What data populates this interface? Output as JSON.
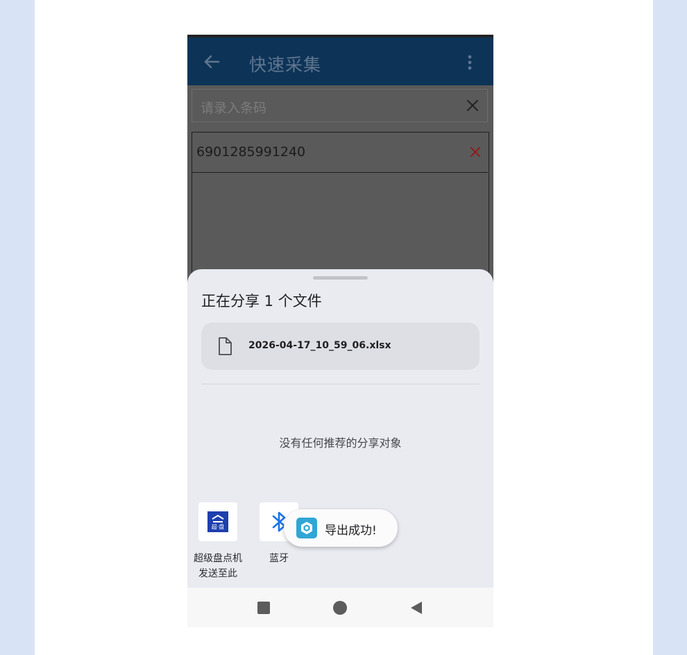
{
  "appbar": {
    "title": "快速采集",
    "back_icon": "arrow-left-icon",
    "more_icon": "more-vertical-icon"
  },
  "scan": {
    "placeholder": "请录入条码",
    "clear_icon": "close-icon"
  },
  "list": {
    "items": [
      {
        "barcode": "6901285991240",
        "delete_icon": "close-icon"
      }
    ]
  },
  "share_sheet": {
    "title": "正在分享 1 个文件",
    "file": {
      "name": "2026-04-17_10_59_06.xlsx",
      "icon": "file-icon"
    },
    "empty_message": "没有任何推荐的分享对象",
    "apps": [
      {
        "label_line1": "超级盘点机",
        "label_line2": "发送至此",
        "icon": "super-inventory-logo-icon",
        "logo_text": "超·盘"
      },
      {
        "label_line1": "蓝牙",
        "icon": "bluetooth-icon"
      }
    ]
  },
  "toast": {
    "text": "导出成功!",
    "icon": "app-logo-icon"
  },
  "navbar": {
    "recent_icon": "square-recent-icon",
    "home_icon": "circle-home-icon",
    "back_icon": "triangle-back-icon"
  },
  "colors": {
    "appbar": "#0d3457",
    "sheet": "#eaebf1",
    "delete": "#b3261e",
    "bluetooth": "#1a73e8"
  }
}
